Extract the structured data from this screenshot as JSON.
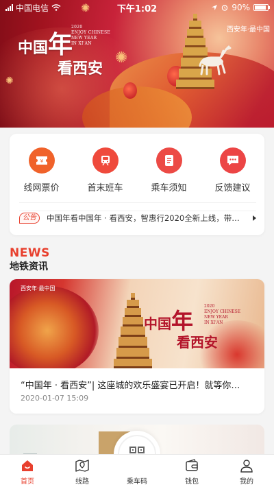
{
  "status_bar": {
    "carrier": "中国电信",
    "time": "下午1:02",
    "battery": "90%",
    "battery_level": 0.9
  },
  "banner": {
    "title_part1": "中国",
    "title_part2": "年",
    "title_part3": "看西安",
    "subtitle_en": "2020\nENJOY CHINESE\nNEW YEAR\nIN XI'AN",
    "brand": "西安年·最中国"
  },
  "menu": {
    "items": [
      {
        "label": "线网票价",
        "icon": "ticket-icon",
        "color": "#f0622a"
      },
      {
        "label": "首末班车",
        "icon": "train-icon",
        "color": "#ef4a3c"
      },
      {
        "label": "乘车须知",
        "icon": "document-icon",
        "color": "#ec4a45"
      },
      {
        "label": "反馈建议",
        "icon": "chat-bubble-icon",
        "color": "#ec4545"
      }
    ],
    "notice_tag": "公告",
    "notice_text": "中国年看中国年 · 看西安，智惠行2020全新上线，带…"
  },
  "news": {
    "heading_en": "NEWS",
    "heading_cn": "地铁资讯",
    "items": [
      {
        "image_title_part1": "中国",
        "image_title_part2": "年",
        "image_title_part3": "看西安",
        "image_subtitle_en": "2020\nENJOY CHINESE\nNEW YEAR\nIN XI'AN",
        "image_brand": "西安年·最中国",
        "title": "“中国年 · 看西安”| 这座城的欢乐盛宴已开启！就等你…",
        "date": "2020-01-07 15:09"
      }
    ]
  },
  "tabbar": {
    "tabs": [
      {
        "label": "首页",
        "icon": "home-icon",
        "active": true
      },
      {
        "label": "线路",
        "icon": "map-pin-icon",
        "active": false
      },
      {
        "label": "乘车码",
        "icon": "qr-code-icon",
        "active": false
      },
      {
        "label": "钱包",
        "icon": "wallet-icon",
        "active": false
      },
      {
        "label": "我的",
        "icon": "user-icon",
        "active": false
      }
    ]
  },
  "colors": {
    "accent": "#e8402e",
    "background": "#f4f4f4"
  }
}
